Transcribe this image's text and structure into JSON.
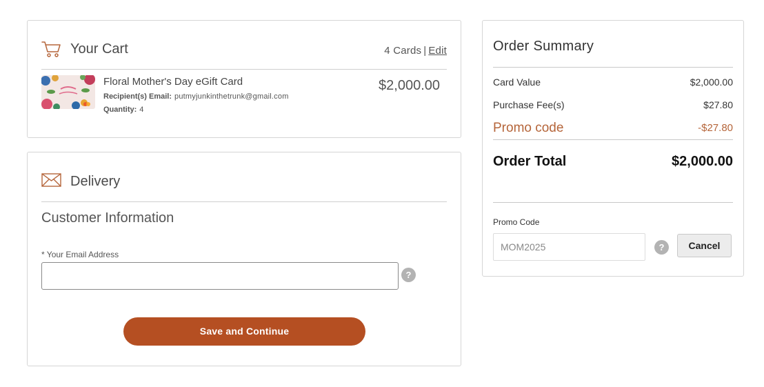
{
  "cart": {
    "title": "Your Cart",
    "count": "4 Cards",
    "separator": "|",
    "edit_label": "Edit",
    "item": {
      "name": "Floral Mother's Day eGift Card",
      "recipient_label": "Recipient(s) Email:",
      "recipient_value": "putmyjunkinthetrunk@gmail.com",
      "quantity_label": "Quantity:",
      "quantity_value": "4",
      "price": "$2,000.00"
    }
  },
  "delivery": {
    "title": "Delivery",
    "section_title": "Customer Information",
    "email_label": "* Your Email Address",
    "email_value": "",
    "help_glyph": "?",
    "save_label": "Save and Continue"
  },
  "summary": {
    "title": "Order Summary",
    "card_value_label": "Card Value",
    "card_value": "$2,000.00",
    "fee_label": "Purchase Fee(s)",
    "fee_value": "$27.80",
    "promo_row_label": "Promo code",
    "promo_row_value": "-$27.80",
    "total_label": "Order Total",
    "total_value": "$2,000.00",
    "promo_input_label": "Promo Code",
    "promo_input_value": "MOM2025",
    "help_glyph": "?",
    "cancel_label": "Cancel"
  },
  "colors": {
    "accent": "#b54f22",
    "promo_text": "#b5653a",
    "icon_stroke": "#b5653a"
  },
  "icons": {
    "cart": "cart-icon",
    "mail": "mail-icon",
    "help": "help-icon"
  }
}
